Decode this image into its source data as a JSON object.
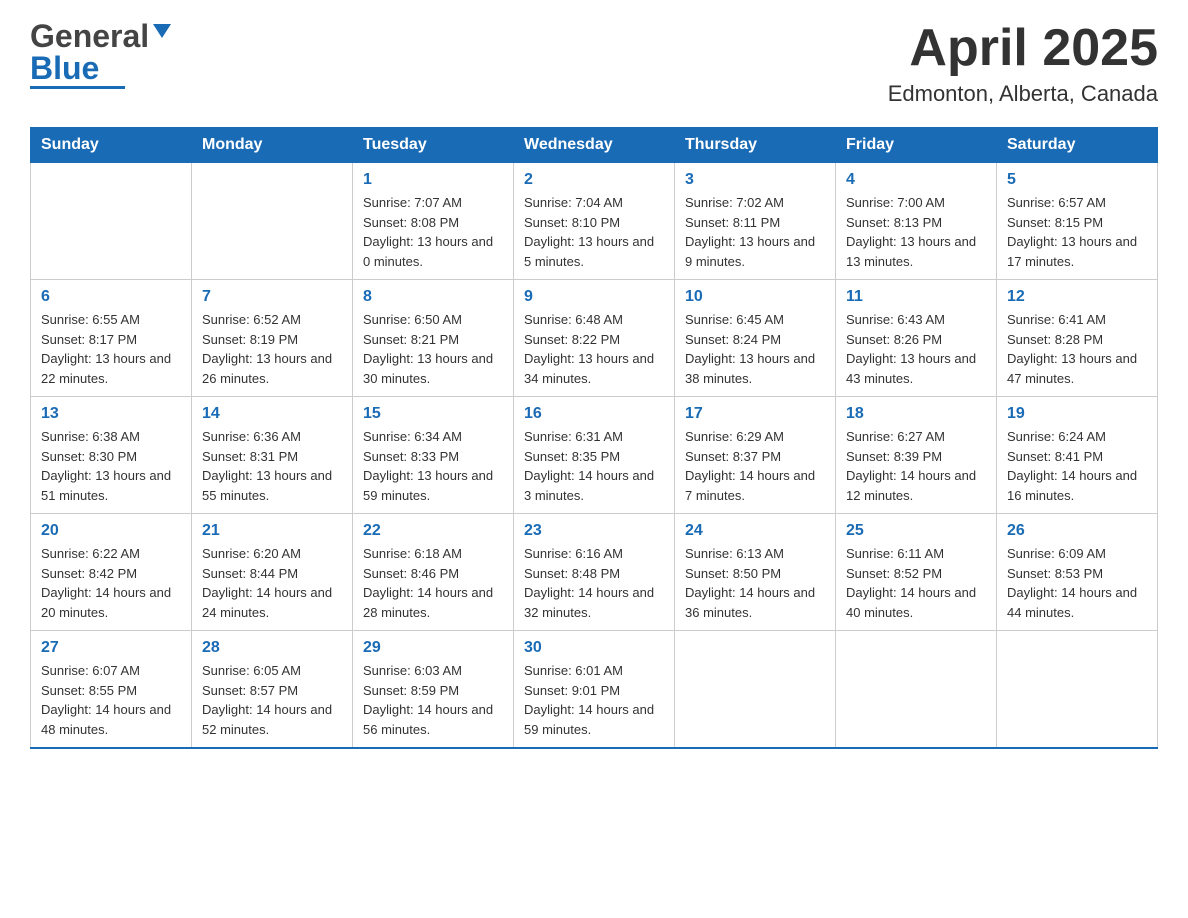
{
  "header": {
    "logo": {
      "general": "General",
      "blue": "Blue",
      "underline_color": "#1a6bb5"
    },
    "title": "April 2025",
    "location": "Edmonton, Alberta, Canada"
  },
  "calendar": {
    "days_of_week": [
      "Sunday",
      "Monday",
      "Tuesday",
      "Wednesday",
      "Thursday",
      "Friday",
      "Saturday"
    ],
    "weeks": [
      [
        {
          "day": "",
          "sunrise": "",
          "sunset": "",
          "daylight": ""
        },
        {
          "day": "",
          "sunrise": "",
          "sunset": "",
          "daylight": ""
        },
        {
          "day": "1",
          "sunrise": "Sunrise: 7:07 AM",
          "sunset": "Sunset: 8:08 PM",
          "daylight": "Daylight: 13 hours and 0 minutes."
        },
        {
          "day": "2",
          "sunrise": "Sunrise: 7:04 AM",
          "sunset": "Sunset: 8:10 PM",
          "daylight": "Daylight: 13 hours and 5 minutes."
        },
        {
          "day": "3",
          "sunrise": "Sunrise: 7:02 AM",
          "sunset": "Sunset: 8:11 PM",
          "daylight": "Daylight: 13 hours and 9 minutes."
        },
        {
          "day": "4",
          "sunrise": "Sunrise: 7:00 AM",
          "sunset": "Sunset: 8:13 PM",
          "daylight": "Daylight: 13 hours and 13 minutes."
        },
        {
          "day": "5",
          "sunrise": "Sunrise: 6:57 AM",
          "sunset": "Sunset: 8:15 PM",
          "daylight": "Daylight: 13 hours and 17 minutes."
        }
      ],
      [
        {
          "day": "6",
          "sunrise": "Sunrise: 6:55 AM",
          "sunset": "Sunset: 8:17 PM",
          "daylight": "Daylight: 13 hours and 22 minutes."
        },
        {
          "day": "7",
          "sunrise": "Sunrise: 6:52 AM",
          "sunset": "Sunset: 8:19 PM",
          "daylight": "Daylight: 13 hours and 26 minutes."
        },
        {
          "day": "8",
          "sunrise": "Sunrise: 6:50 AM",
          "sunset": "Sunset: 8:21 PM",
          "daylight": "Daylight: 13 hours and 30 minutes."
        },
        {
          "day": "9",
          "sunrise": "Sunrise: 6:48 AM",
          "sunset": "Sunset: 8:22 PM",
          "daylight": "Daylight: 13 hours and 34 minutes."
        },
        {
          "day": "10",
          "sunrise": "Sunrise: 6:45 AM",
          "sunset": "Sunset: 8:24 PM",
          "daylight": "Daylight: 13 hours and 38 minutes."
        },
        {
          "day": "11",
          "sunrise": "Sunrise: 6:43 AM",
          "sunset": "Sunset: 8:26 PM",
          "daylight": "Daylight: 13 hours and 43 minutes."
        },
        {
          "day": "12",
          "sunrise": "Sunrise: 6:41 AM",
          "sunset": "Sunset: 8:28 PM",
          "daylight": "Daylight: 13 hours and 47 minutes."
        }
      ],
      [
        {
          "day": "13",
          "sunrise": "Sunrise: 6:38 AM",
          "sunset": "Sunset: 8:30 PM",
          "daylight": "Daylight: 13 hours and 51 minutes."
        },
        {
          "day": "14",
          "sunrise": "Sunrise: 6:36 AM",
          "sunset": "Sunset: 8:31 PM",
          "daylight": "Daylight: 13 hours and 55 minutes."
        },
        {
          "day": "15",
          "sunrise": "Sunrise: 6:34 AM",
          "sunset": "Sunset: 8:33 PM",
          "daylight": "Daylight: 13 hours and 59 minutes."
        },
        {
          "day": "16",
          "sunrise": "Sunrise: 6:31 AM",
          "sunset": "Sunset: 8:35 PM",
          "daylight": "Daylight: 14 hours and 3 minutes."
        },
        {
          "day": "17",
          "sunrise": "Sunrise: 6:29 AM",
          "sunset": "Sunset: 8:37 PM",
          "daylight": "Daylight: 14 hours and 7 minutes."
        },
        {
          "day": "18",
          "sunrise": "Sunrise: 6:27 AM",
          "sunset": "Sunset: 8:39 PM",
          "daylight": "Daylight: 14 hours and 12 minutes."
        },
        {
          "day": "19",
          "sunrise": "Sunrise: 6:24 AM",
          "sunset": "Sunset: 8:41 PM",
          "daylight": "Daylight: 14 hours and 16 minutes."
        }
      ],
      [
        {
          "day": "20",
          "sunrise": "Sunrise: 6:22 AM",
          "sunset": "Sunset: 8:42 PM",
          "daylight": "Daylight: 14 hours and 20 minutes."
        },
        {
          "day": "21",
          "sunrise": "Sunrise: 6:20 AM",
          "sunset": "Sunset: 8:44 PM",
          "daylight": "Daylight: 14 hours and 24 minutes."
        },
        {
          "day": "22",
          "sunrise": "Sunrise: 6:18 AM",
          "sunset": "Sunset: 8:46 PM",
          "daylight": "Daylight: 14 hours and 28 minutes."
        },
        {
          "day": "23",
          "sunrise": "Sunrise: 6:16 AM",
          "sunset": "Sunset: 8:48 PM",
          "daylight": "Daylight: 14 hours and 32 minutes."
        },
        {
          "day": "24",
          "sunrise": "Sunrise: 6:13 AM",
          "sunset": "Sunset: 8:50 PM",
          "daylight": "Daylight: 14 hours and 36 minutes."
        },
        {
          "day": "25",
          "sunrise": "Sunrise: 6:11 AM",
          "sunset": "Sunset: 8:52 PM",
          "daylight": "Daylight: 14 hours and 40 minutes."
        },
        {
          "day": "26",
          "sunrise": "Sunrise: 6:09 AM",
          "sunset": "Sunset: 8:53 PM",
          "daylight": "Daylight: 14 hours and 44 minutes."
        }
      ],
      [
        {
          "day": "27",
          "sunrise": "Sunrise: 6:07 AM",
          "sunset": "Sunset: 8:55 PM",
          "daylight": "Daylight: 14 hours and 48 minutes."
        },
        {
          "day": "28",
          "sunrise": "Sunrise: 6:05 AM",
          "sunset": "Sunset: 8:57 PM",
          "daylight": "Daylight: 14 hours and 52 minutes."
        },
        {
          "day": "29",
          "sunrise": "Sunrise: 6:03 AM",
          "sunset": "Sunset: 8:59 PM",
          "daylight": "Daylight: 14 hours and 56 minutes."
        },
        {
          "day": "30",
          "sunrise": "Sunrise: 6:01 AM",
          "sunset": "Sunset: 9:01 PM",
          "daylight": "Daylight: 14 hours and 59 minutes."
        },
        {
          "day": "",
          "sunrise": "",
          "sunset": "",
          "daylight": ""
        },
        {
          "day": "",
          "sunrise": "",
          "sunset": "",
          "daylight": ""
        },
        {
          "day": "",
          "sunrise": "",
          "sunset": "",
          "daylight": ""
        }
      ]
    ]
  }
}
